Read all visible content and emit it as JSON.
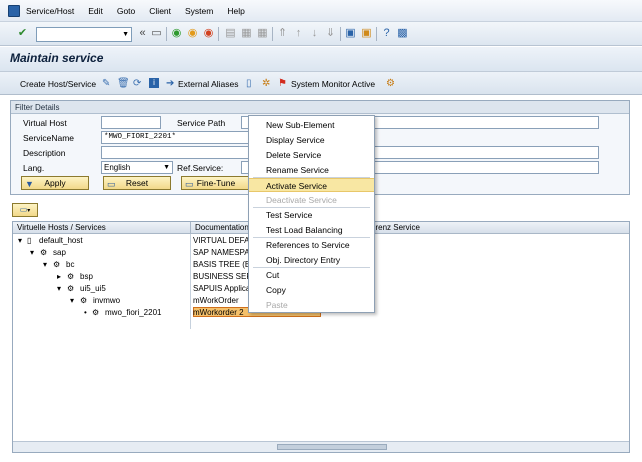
{
  "menubar": {
    "items": [
      "Service/Host",
      "Edit",
      "Goto",
      "Client",
      "System",
      "Help"
    ]
  },
  "toolbar": {
    "command_value": "",
    "icons": [
      "enter-icon",
      "save-icon",
      "back-icon",
      "exit-icon",
      "cancel-icon",
      "print-icon",
      "find-icon",
      "first-page-icon",
      "new-session-icon",
      "shortcut-icon",
      "help-icon",
      "customize-icon"
    ]
  },
  "page": {
    "title": "Maintain service"
  },
  "app_toolbar": {
    "create_host": "Create Host/Service",
    "external_aliases": "External Aliases",
    "system_monitor": "System Monitor Active"
  },
  "filter": {
    "title": "Filter Details",
    "virtual_host_label": "Virtual Host",
    "virtual_host_value": "",
    "service_path_label": "Service Path",
    "service_name_label": "ServiceName",
    "service_name_value": "*MWO_FIORI_2201*",
    "description_label": "Description",
    "lang_label": "Lang.",
    "lang_value": "English",
    "ref_service_label": "Ref.Service:",
    "apply": "Apply",
    "reset": "Reset",
    "fine_tune": "Fine-Tune"
  },
  "tree": {
    "col1": "Virtuelle Hosts / Services",
    "col2": "Documentation",
    "col3": "erenz Service",
    "rows": [
      {
        "name": "default_host",
        "doc": "VIRTUAL DEFA"
      },
      {
        "name": "sap",
        "doc": "SAP NAMESPA"
      },
      {
        "name": "bc",
        "doc": "BASIS TREE (B"
      },
      {
        "name": "bsp",
        "doc": "BUSINESS SER"
      },
      {
        "name": "ui5_ui5",
        "doc": "SAPUIS Applica"
      },
      {
        "name": "invmwo",
        "doc": "mWorkOrder"
      },
      {
        "name": "mwo_fiori_2201",
        "doc": "mWorkorder 2"
      }
    ]
  },
  "context_menu": {
    "items": [
      {
        "label": "New Sub-Element"
      },
      {
        "label": "Display Service"
      },
      {
        "label": "Delete Service"
      },
      {
        "label": "Rename Service"
      },
      {
        "label": "Activate Service"
      },
      {
        "label": "Deactivate Service"
      },
      {
        "label": "Test Service"
      },
      {
        "label": "Test Load Balancing"
      },
      {
        "label": "References to Service"
      },
      {
        "label": "Obj. Directory Entry"
      },
      {
        "label": "Cut"
      },
      {
        "label": "Copy"
      },
      {
        "label": "Paste"
      }
    ]
  }
}
